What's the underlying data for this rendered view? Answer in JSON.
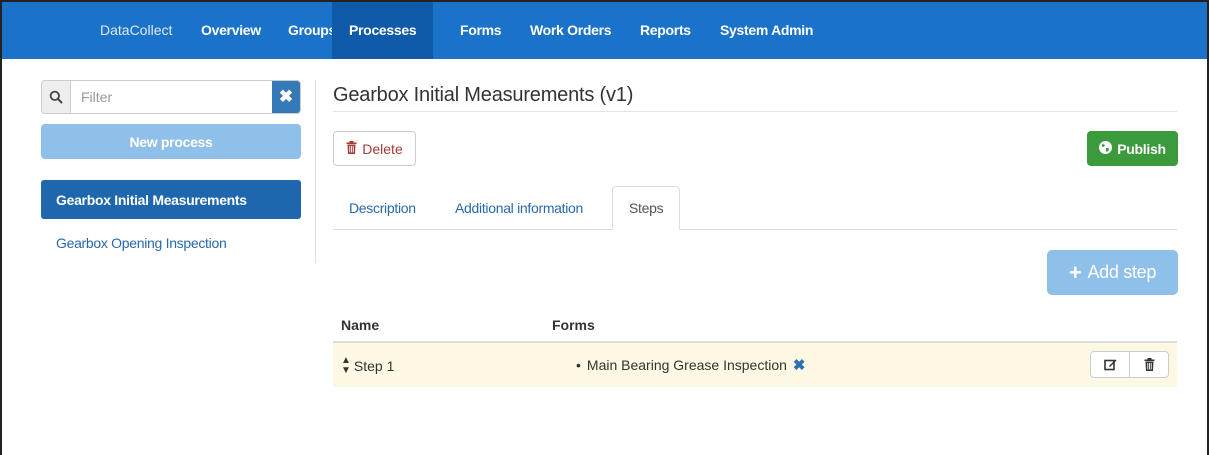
{
  "navbar": {
    "brand": "DataCollect",
    "items": [
      {
        "label": "Overview",
        "active": false
      },
      {
        "label": "Groups",
        "active": false
      },
      {
        "label": "Processes",
        "active": true
      },
      {
        "label": "Forms",
        "active": false
      },
      {
        "label": "Work Orders",
        "active": false
      },
      {
        "label": "Reports",
        "active": false
      },
      {
        "label": "System Admin",
        "active": false
      }
    ],
    "color": "#1a72c9"
  },
  "sidebar": {
    "filter_placeholder": "Filter",
    "new_process_label": "New process",
    "processes": [
      {
        "label": "Gearbox Initial Measurements",
        "active": true
      },
      {
        "label": "Gearbox Opening Inspection",
        "active": false
      }
    ]
  },
  "main": {
    "title": "Gearbox Initial Measurements (v1)",
    "delete_label": "Delete",
    "publish_label": "Publish",
    "tabs": [
      {
        "label": "Description",
        "active": false
      },
      {
        "label": "Additional information",
        "active": false
      },
      {
        "label": "Steps",
        "active": true
      }
    ],
    "add_step_label": "Add step",
    "table": {
      "headers": [
        "Name",
        "Forms"
      ],
      "rows": [
        {
          "name": "Step 1",
          "forms": [
            "Main Bearing Grease Inspection"
          ]
        }
      ]
    }
  },
  "icons": {
    "filter": "search-icon",
    "clear": "close-icon",
    "delete": "trash-icon",
    "publish": "globe-icon",
    "add": "plus-icon",
    "sort": "sort-icon",
    "edit": "edit-icon"
  },
  "colors": {
    "primary": "#337ab7",
    "success": "#3a9a3c",
    "danger": "#a63a36",
    "disabled_primary": "#8ec0ea",
    "row_highlight": "#fcf8e3"
  }
}
